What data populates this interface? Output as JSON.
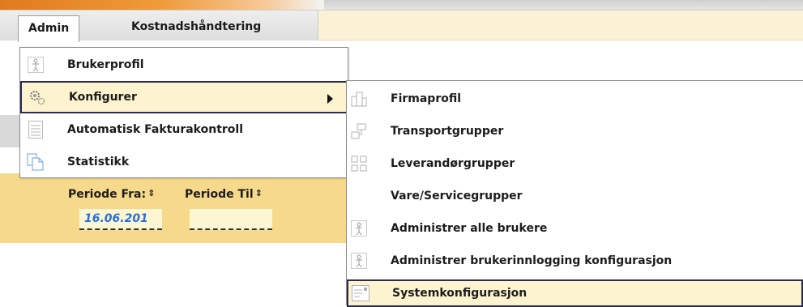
{
  "menubar": {
    "tabs": [
      {
        "label": "Admin"
      },
      {
        "label": "Kostnadshåndtering"
      }
    ]
  },
  "admin_menu": {
    "items": [
      {
        "label": "Brukerprofil",
        "icon": "person-icon"
      },
      {
        "label": "Konfigurer",
        "icon": "gear-icon",
        "has_submenu": true,
        "highlighted": true
      },
      {
        "label": "Automatisk Fakturakontroll",
        "icon": "document-icon"
      },
      {
        "label": "Statistikk",
        "icon": "copy-pages-icon"
      }
    ]
  },
  "konfigurer_submenu": {
    "items": [
      {
        "label": "Firmaprofil",
        "icon": "company-icon"
      },
      {
        "label": "Transportgrupper",
        "icon": "transport-group-icon"
      },
      {
        "label": "Leverandørgrupper",
        "icon": "supplier-group-icon"
      },
      {
        "label": "Vare/Servicegrupper",
        "icon": ""
      },
      {
        "label": "Administrer alle brukere",
        "icon": "person-icon"
      },
      {
        "label": "Administrer brukerinnlogging konfigurasjon",
        "icon": "person-icon"
      },
      {
        "label": "Systemkonfigurasjon",
        "icon": "system-config-icon",
        "highlighted": true
      }
    ]
  },
  "filters": {
    "periode_fra_label": "Periode Fra:",
    "periode_til_label": "Periode Til",
    "periode_fra_value": "16.06.201",
    "periode_til_value": ""
  },
  "colors": {
    "menubar_bg": "#fbf2d6",
    "content_band": "#f7d98c",
    "highlight_bg": "#fdf4cf",
    "highlight_border": "#2b2b52",
    "date_text": "#2a6fd8"
  }
}
